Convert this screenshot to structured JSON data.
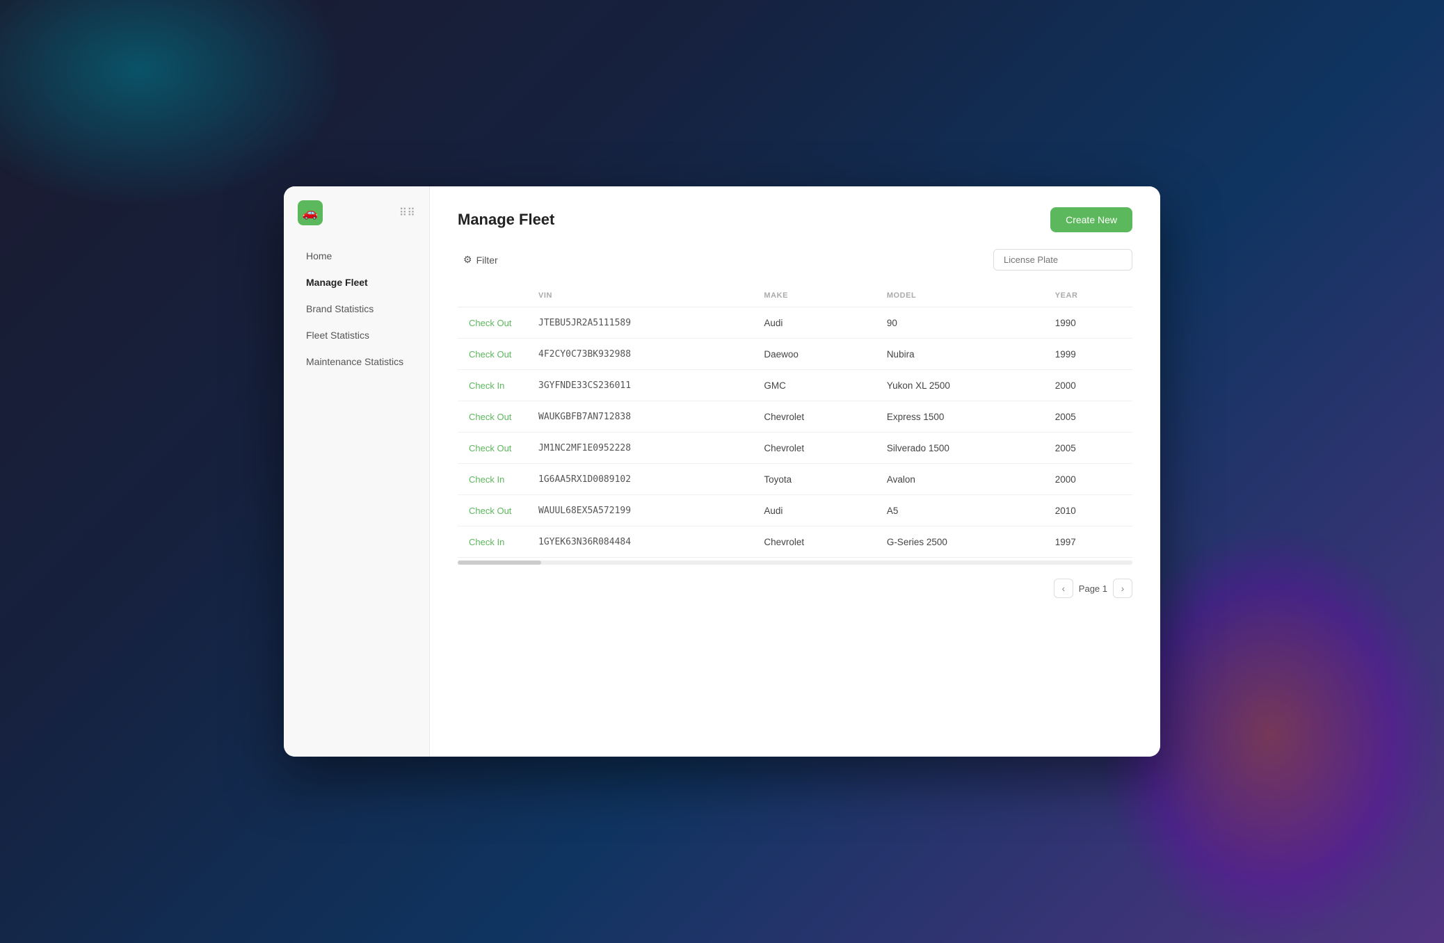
{
  "app": {
    "logo_icon": "🚗",
    "grid_icon": "⠿"
  },
  "sidebar": {
    "items": [
      {
        "id": "home",
        "label": "Home",
        "active": false
      },
      {
        "id": "manage-fleet",
        "label": "Manage Fleet",
        "active": true
      },
      {
        "id": "brand-statistics",
        "label": "Brand Statistics",
        "active": false
      },
      {
        "id": "fleet-statistics",
        "label": "Fleet Statistics",
        "active": false
      },
      {
        "id": "maintenance-statistics",
        "label": "Maintenance Statistics",
        "active": false
      }
    ]
  },
  "header": {
    "title": "Manage Fleet",
    "create_button": "Create New"
  },
  "toolbar": {
    "filter_label": "Filter",
    "search_placeholder": "License Plate"
  },
  "table": {
    "columns": [
      "",
      "VIN",
      "MAKE",
      "MODEL",
      "YEAR"
    ],
    "rows": [
      {
        "status": "Check Out",
        "status_type": "checkout",
        "vin": "JTEBU5JR2A5111589",
        "make": "Audi",
        "model": "90",
        "year": "1990"
      },
      {
        "status": "Check Out",
        "status_type": "checkout",
        "vin": "4F2CY0C73BK932988",
        "make": "Daewoo",
        "model": "Nubira",
        "year": "1999"
      },
      {
        "status": "Check In",
        "status_type": "checkin",
        "vin": "3GYFNDE33CS236011",
        "make": "GMC",
        "model": "Yukon XL 2500",
        "year": "2000"
      },
      {
        "status": "Check Out",
        "status_type": "checkout",
        "vin": "WAUKGBFB7AN712838",
        "make": "Chevrolet",
        "model": "Express 1500",
        "year": "2005"
      },
      {
        "status": "Check Out",
        "status_type": "checkout",
        "vin": "JM1NC2MF1E0952228",
        "make": "Chevrolet",
        "model": "Silverado 1500",
        "year": "2005"
      },
      {
        "status": "Check In",
        "status_type": "checkin",
        "vin": "1G6AA5RX1D0089102",
        "make": "Toyota",
        "model": "Avalon",
        "year": "2000"
      },
      {
        "status": "Check Out",
        "status_type": "checkout",
        "vin": "WAUUL68EX5A572199",
        "make": "Audi",
        "model": "A5",
        "year": "2010"
      },
      {
        "status": "Check In",
        "status_type": "checkin",
        "vin": "1GYEK63N36R084484",
        "make": "Chevrolet",
        "model": "G-Series 2500",
        "year": "1997"
      }
    ]
  },
  "pagination": {
    "prev_icon": "‹",
    "next_icon": "›",
    "page_label": "Page 1"
  }
}
